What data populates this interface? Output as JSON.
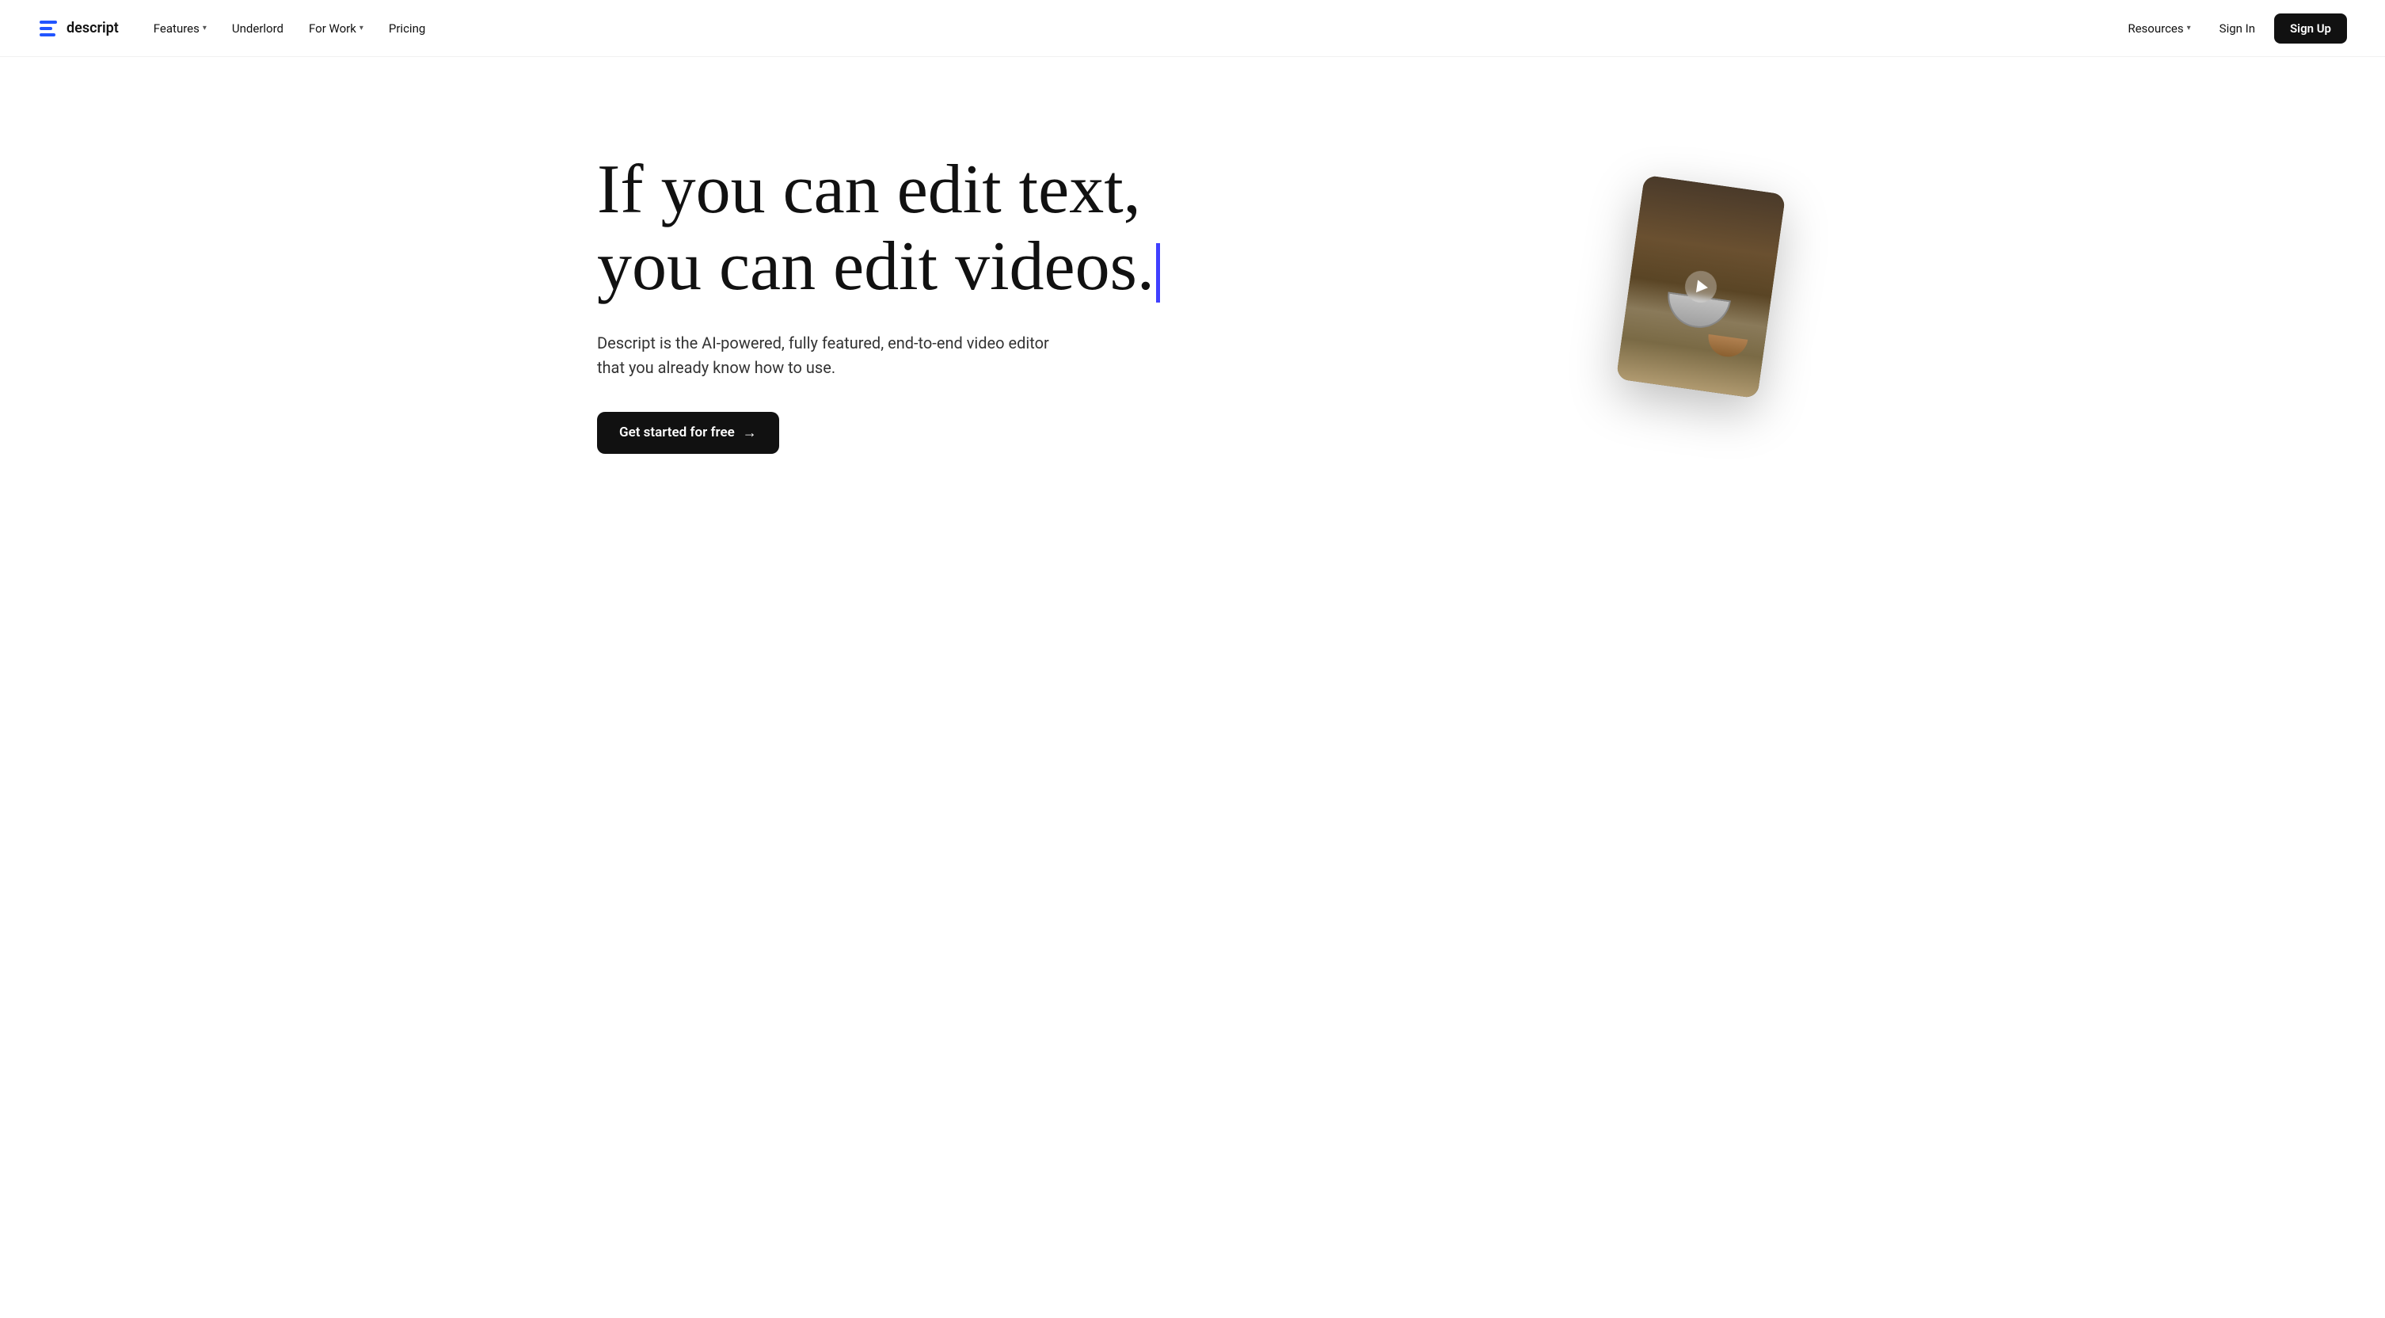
{
  "nav": {
    "logo_text": "descript",
    "links": [
      {
        "label": "Features",
        "has_dropdown": true
      },
      {
        "label": "Underlord",
        "has_dropdown": false
      },
      {
        "label": "For Work",
        "has_dropdown": true
      },
      {
        "label": "Pricing",
        "has_dropdown": false
      }
    ],
    "right_links": [
      {
        "label": "Resources",
        "has_dropdown": true
      }
    ],
    "sign_in_label": "Sign In",
    "sign_up_label": "Sign Up"
  },
  "hero": {
    "headline_line1": "If you can edit text,",
    "headline_line2": "you can edit videos.",
    "subtext": "Descript is the AI-powered, fully featured, end-to-end video editor that you already know how to use.",
    "cta_label": "Get started for free",
    "cta_arrow": "→",
    "cursor_color": "#4040ff"
  }
}
